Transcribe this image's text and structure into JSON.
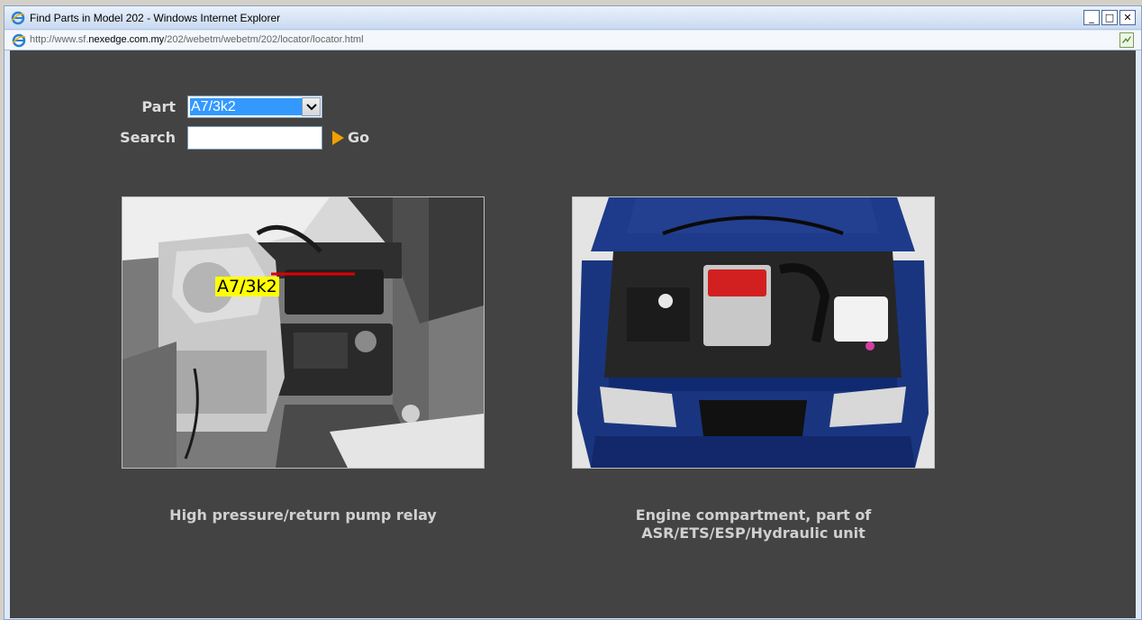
{
  "window": {
    "title": "Find Parts in Model 202 - Windows Internet Explorer",
    "minimize": "_",
    "maximize": "□",
    "close": "✕"
  },
  "address": {
    "prefix": "http://www.sf.",
    "domain": "nexedge.com.my",
    "path": "/202/webetm/webetm/202/locator/locator.html"
  },
  "form": {
    "part_label": "Part",
    "part_value": "A7/3k2",
    "search_label": "Search",
    "search_value": "",
    "go_label": "Go"
  },
  "images": {
    "left": {
      "tag": "A7/3k2",
      "caption": "High pressure/return pump relay"
    },
    "right": {
      "caption_line1": "Engine compartment, part of",
      "caption_line2": "ASR/ETS/ESP/Hydraulic unit"
    }
  },
  "colors": {
    "background": "#434343",
    "accent": "#3399ff",
    "go_arrow": "#f0a000",
    "tag_highlight": "#ffff00",
    "leader_line": "#e00000",
    "car_blue": "#1e3a8a"
  }
}
